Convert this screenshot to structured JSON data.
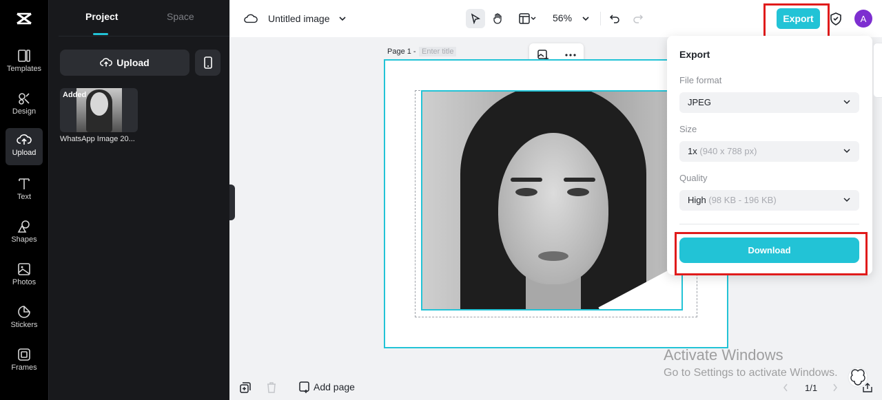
{
  "rail": {
    "items": [
      {
        "label": "Templates",
        "icon": "templates-icon"
      },
      {
        "label": "Design",
        "icon": "design-icon"
      },
      {
        "label": "Upload",
        "icon": "upload-cloud-icon"
      },
      {
        "label": "Text",
        "icon": "text-icon"
      },
      {
        "label": "Shapes",
        "icon": "shapes-icon"
      },
      {
        "label": "Photos",
        "icon": "photos-icon"
      },
      {
        "label": "Stickers",
        "icon": "stickers-icon"
      },
      {
        "label": "Frames",
        "icon": "frames-icon"
      }
    ],
    "active": "Upload"
  },
  "panel": {
    "tabs": [
      "Project",
      "Space"
    ],
    "active_tab": "Project",
    "upload_label": "Upload",
    "media": [
      {
        "badge": "Added",
        "name": "WhatsApp Image 20..."
      }
    ]
  },
  "topbar": {
    "doc_title": "Untitled image",
    "zoom": "56%",
    "export_label": "Export",
    "avatar_initial": "A"
  },
  "canvas": {
    "page_label": "Page 1 -",
    "title_placeholder": "Enter title"
  },
  "export_panel": {
    "title": "Export",
    "file_format_label": "File format",
    "file_format_value": "JPEG",
    "size_label": "Size",
    "size_value": "1x",
    "size_hint": "(940 x 788 px)",
    "quality_label": "Quality",
    "quality_value": "High",
    "quality_hint": "(98 KB - 196 KB)",
    "download_label": "Download"
  },
  "bottombar": {
    "add_page_label": "Add page",
    "pager": "1/1"
  },
  "watermark": {
    "line1": "Activate Windows",
    "line2": "Go to Settings to activate Windows."
  },
  "colors": {
    "accent": "#22c3d6",
    "highlight": "#e01b1b",
    "avatar": "#7d2fd0"
  }
}
